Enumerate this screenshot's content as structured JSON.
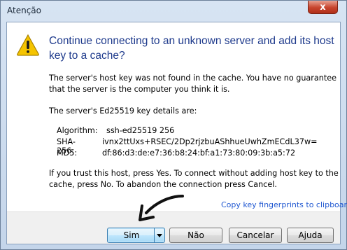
{
  "window": {
    "title": "Atenção",
    "close_label": "x"
  },
  "dialog": {
    "main_instruction": "Continue connecting to an unknown server and add its host key to a cache?",
    "paragraph1": "The server's host key was not found in the cache. You have no guarantee that the server is the computer you think it is.",
    "paragraph2": "The server's Ed25519 key details are:",
    "key_details": [
      {
        "label": "Algorithm:",
        "value": "ssh-ed25519 256"
      },
      {
        "label": "SHA-256:",
        "value": "ivnx2ttUxs+RSEC/2Dp2rjzbuAShhueUwhZmECdL37w="
      },
      {
        "label": "MD5:",
        "value": "df:86:d3:de:e7:36:b8:24:bf:a1:73:80:09:3b:a5:72"
      }
    ],
    "paragraph3": "If you trust this host, press Yes. To connect without adding host key to the cache, press No. To abandon the connection press Cancel.",
    "copy_link": "Copy key fingerprints to clipboard"
  },
  "buttons": {
    "yes": "Sim",
    "no": "Não",
    "cancel": "Cancelar",
    "help": "Ajuda"
  },
  "icons": {
    "warning": "warning-icon",
    "close": "close-icon",
    "dropdown": "chevron-down-icon",
    "annotation": "annotation-arrow"
  },
  "colors": {
    "instruction": "#1e3a8c",
    "link": "#1f57d1",
    "warning_fill": "#f5c400"
  }
}
